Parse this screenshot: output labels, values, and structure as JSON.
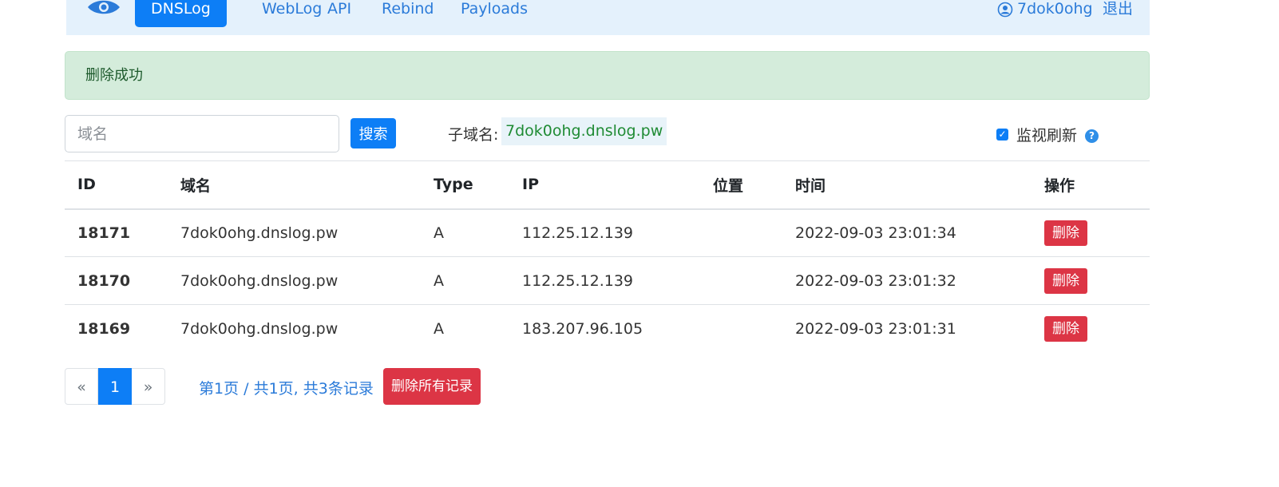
{
  "nav": {
    "logo_icon": "eye-icon",
    "items": [
      {
        "label": "DNSLog",
        "active": true
      },
      {
        "label": "WebLog",
        "active": false
      },
      {
        "label": "API",
        "active": false
      },
      {
        "label": "Rebind",
        "active": false
      },
      {
        "label": "Payloads",
        "active": false
      }
    ],
    "user_icon": "user-circle-icon",
    "username": "7dok0ohg",
    "logout_label": "退出"
  },
  "alert": {
    "message": "删除成功"
  },
  "search": {
    "placeholder": "域名",
    "button_label": "搜索"
  },
  "subdomain": {
    "label": "子域名:",
    "value": "7dok0ohg.dnslog.pw"
  },
  "monitor": {
    "label": "监视刷新",
    "checked": true,
    "help_icon": "question-circle-icon"
  },
  "table": {
    "headers": [
      "ID",
      "域名",
      "Type",
      "IP",
      "位置",
      "时间",
      "操作"
    ],
    "rows": [
      {
        "id": "18171",
        "domain": "7dok0ohg.dnslog.pw",
        "type": "A",
        "ip": "112.25.12.139",
        "location": "",
        "time": "2022-09-03 23:01:34",
        "action": "删除"
      },
      {
        "id": "18170",
        "domain": "7dok0ohg.dnslog.pw",
        "type": "A",
        "ip": "112.25.12.139",
        "location": "",
        "time": "2022-09-03 23:01:32",
        "action": "删除"
      },
      {
        "id": "18169",
        "domain": "7dok0ohg.dnslog.pw",
        "type": "A",
        "ip": "183.207.96.105",
        "location": "",
        "time": "2022-09-03 23:01:31",
        "action": "删除"
      }
    ]
  },
  "pagination": {
    "prev": "«",
    "current": "1",
    "next": "»",
    "info": "第1页 / 共1页, 共3条记录"
  },
  "delete_all_label": "删除所有记录",
  "colors": {
    "primary": "#0d7ef6",
    "danger": "#dc3545",
    "success_bg": "#d4ecdb",
    "link": "#2b7bd9"
  }
}
